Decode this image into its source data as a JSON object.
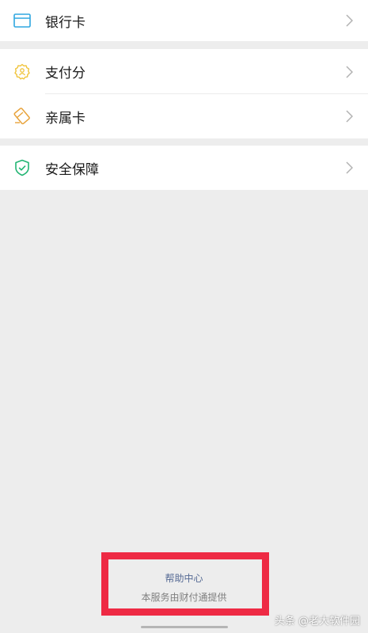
{
  "menu": {
    "bank_card": {
      "label": "银行卡",
      "icon": "bank-card-icon",
      "color": "#2fa7e0"
    },
    "pay_score": {
      "label": "支付分",
      "icon": "pay-score-icon",
      "color": "#f0c43c"
    },
    "family_card": {
      "label": "亲属卡",
      "icon": "family-card-icon",
      "color": "#e8a33b"
    },
    "security": {
      "label": "安全保障",
      "icon": "shield-check-icon",
      "color": "#22b573"
    }
  },
  "footer": {
    "help_center": "帮助中心",
    "provider_note": "本服务由财付通提供"
  },
  "watermark": "头条 @老大软件园",
  "highlight_color": "#ee2a44"
}
